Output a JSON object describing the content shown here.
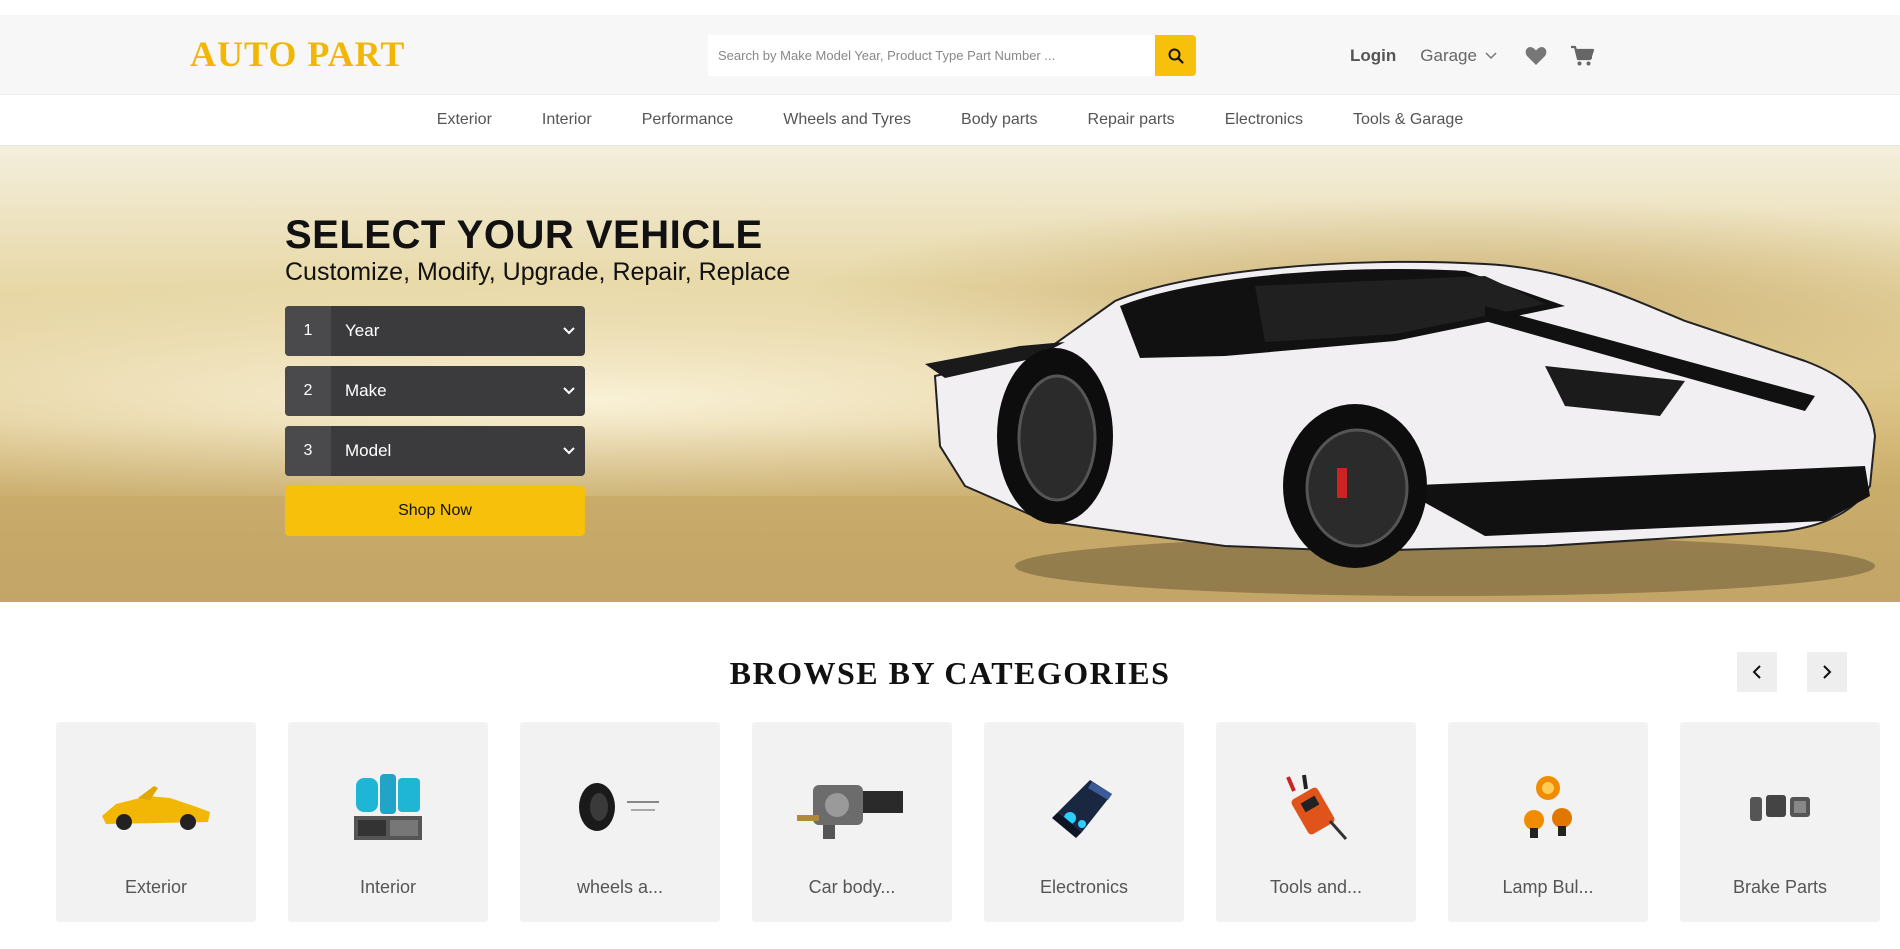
{
  "header": {
    "logo": "AUTO PART",
    "search_placeholder": "Search by Make Model Year, Product Type Part Number ...",
    "login_label": "Login",
    "garage_label": "Garage"
  },
  "nav": {
    "items": [
      "Exterior",
      "Interior",
      "Performance",
      "Wheels and Tyres",
      "Body parts",
      "Repair parts",
      "Electronics",
      "Tools & Garage"
    ]
  },
  "hero": {
    "title": "SELECT YOUR VEHICLE",
    "subtitle": "Customize, Modify, Upgrade, Repair, Replace",
    "selects": [
      {
        "num": "1",
        "label": "Year"
      },
      {
        "num": "2",
        "label": "Make"
      },
      {
        "num": "3",
        "label": "Model"
      }
    ],
    "cta": "Shop Now"
  },
  "browse": {
    "title": "BROWSE BY CATEGORIES",
    "cards": [
      {
        "name": "Exterior",
        "icon": "sports-car-icon"
      },
      {
        "name": "Interior",
        "icon": "seat-cover-icon"
      },
      {
        "name": "wheels a...",
        "icon": "tyre-icon"
      },
      {
        "name": "Car body...",
        "icon": "carburetor-icon"
      },
      {
        "name": "Electronics",
        "icon": "car-charger-icon"
      },
      {
        "name": "Tools and...",
        "icon": "battery-charger-icon"
      },
      {
        "name": "Lamp Bul...",
        "icon": "lamp-bulb-icon"
      },
      {
        "name": "Brake Parts",
        "icon": "brake-pads-icon"
      }
    ]
  },
  "colors": {
    "accent": "#f7c00a",
    "logo": "#f2b705",
    "select_bg": "#3b3b3d"
  }
}
